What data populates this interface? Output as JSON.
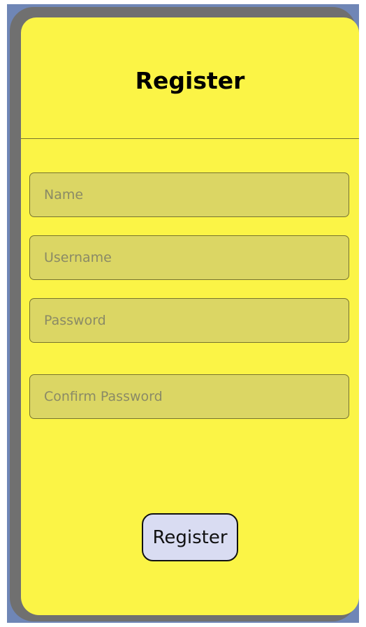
{
  "form": {
    "title": "Register",
    "fields": {
      "name": {
        "placeholder": "Name",
        "value": ""
      },
      "username": {
        "placeholder": "Username",
        "value": ""
      },
      "password": {
        "placeholder": "Password",
        "value": ""
      },
      "confirm_password": {
        "placeholder": "Confirm Password",
        "value": ""
      }
    },
    "submit_label": "Register"
  },
  "colors": {
    "background": "#fbf446",
    "input_fill": "#dbd664",
    "button_fill": "#d9dcf2",
    "frame": "#707070",
    "backdrop": "#6f86b6"
  }
}
